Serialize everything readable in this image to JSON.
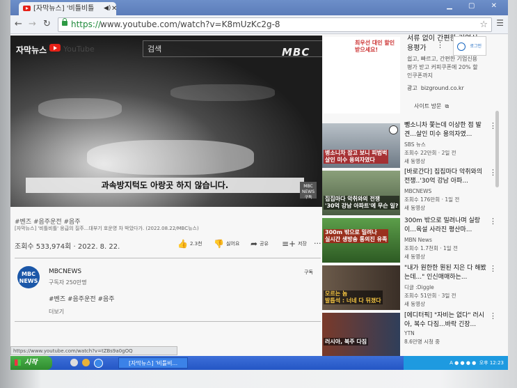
{
  "browser": {
    "tab_title": "[자막뉴스] '비틀비틀",
    "url_scheme": "https://",
    "url_rest": "www.youtube.com/watch?v=K8mUzKc2g-8",
    "status_url": "https://www.youtube.com/watch?v=tZBs9a0gOQ"
  },
  "header": {
    "logo_text": "자막뉴스",
    "logo_word": "YouTube",
    "search_placeholder": "검색",
    "login_label": "로그인"
  },
  "video": {
    "overlay_logo": "MBC",
    "caption": "과속방지턱도 아랑곳 하지 않습니다.",
    "corner_badge": "MBC\nNEWS\n구독",
    "hashtags": "#벤즈 #음주운전 #음주",
    "description": "[자막뉴스] '비틀비틀' 응급의 질주...대부기 호운영 차 박았다가. (2022.08.22/MBC뉴스)",
    "views_date": "조회수 533,974회 · 2022. 8. 22.",
    "actions": {
      "like": "2.3천",
      "dislike": "싫어요",
      "share": "공유",
      "save": "저장"
    }
  },
  "channel": {
    "avatar_text": "MBC\nNEWS",
    "name": "MBCNEWS",
    "subscribers": "구독자 250만명",
    "subscribe_label": "구독",
    "tags": "#벤즈 #음주운전 #음주",
    "more": "더보기"
  },
  "ad": {
    "image_text": "최우선 대인 할인받으세요!",
    "title": "서류 없이 간편한 기업신용평가",
    "desc": "쉽고, 빠르고, 간편한 기업신용평가 받고 커피쿠폰에 20% 할인쿠폰까지",
    "label": "광고",
    "source": "bizground.co.kr",
    "site_button": "사이트 방문"
  },
  "related": [
    {
      "thumb_caption": "병소니차 잡고 보니 피범벅\n살인 미수 용의자였다",
      "title": "뺑소니차 쫓는데 이상한 점 발견...살인 미수 용의자였...",
      "channel": "SBS 뉴스",
      "meta": "조회수 22만회 · 2일 전",
      "badge": "새 동영상"
    },
    {
      "thumb_caption": "집집마다 악취와의 전쟁\n'30억 강남 아파트'에 무슨 일?",
      "title": "[바로간다] 집집마다 악취와의 전쟁..'30억 강남 아파...",
      "channel": "MBCNEWS",
      "meta": "조회수 176만회 · 1일 전",
      "badge": "새 동영상"
    },
    {
      "thumb_caption": "300m 밖으로 밀려나\n실시간 생방송 통의진 유족",
      "title": "300m 밖으로 밀려나며 실랑이...육설 사라진 평산마...",
      "channel": "MBN News",
      "meta": "조회수 1.7천회 · 1일 전",
      "badge": "새 동영상"
    },
    {
      "thumb_caption": "모르는 놈\n발톱석 : 너네 다 뒤졌다",
      "title": "\"내가 원한한 뭔된 지은 다 해봤는데...\" 인신매매하는...",
      "channel": "디글 :Diggle",
      "meta": "조회수 51만회 · 3일 전",
      "badge": "새 동영상"
    },
    {
      "thumb_caption": "러시아, 북주 다짐",
      "title": "[에디터픽] \"자비는 없다\" 러시아, 복수 다짐...바락 긴장...",
      "channel": "YTN",
      "meta": "8.6만명 시청 중",
      "badge": ""
    }
  ],
  "taskbar": {
    "start_label": "시작",
    "task_label": "[자막뉴스] '비틀비...",
    "clock": "오후 12:23"
  }
}
